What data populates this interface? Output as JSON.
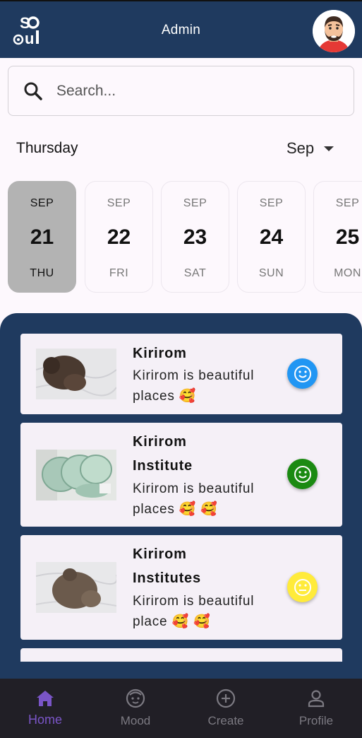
{
  "header": {
    "title": "Admin",
    "logo_text": "Soul",
    "bg_color": "#1f3a5f"
  },
  "search": {
    "placeholder": "Search...",
    "value": ""
  },
  "calendar": {
    "day_label": "Thursday",
    "month_select": "Sep",
    "dates": [
      {
        "month": "SEP",
        "day": "21",
        "weekday": "THU",
        "selected": true
      },
      {
        "month": "SEP",
        "day": "22",
        "weekday": "FRI",
        "selected": false
      },
      {
        "month": "SEP",
        "day": "23",
        "weekday": "SAT",
        "selected": false
      },
      {
        "month": "SEP",
        "day": "24",
        "weekday": "SUN",
        "selected": false
      },
      {
        "month": "SEP",
        "day": "25",
        "weekday": "MON",
        "selected": false
      }
    ]
  },
  "feed": {
    "posts": [
      {
        "title_lines": [
          "Kirirom"
        ],
        "body_lines": [
          "Kirirom is beautiful",
          "places 🥰"
        ],
        "mood": "happy",
        "mood_color": "#2196f3",
        "image": "cat-on-blanket"
      },
      {
        "title_lines": [
          "Kirirom",
          "Institute"
        ],
        "body_lines": [
          "Kirirom is beautiful",
          "places 🥰 🥰"
        ],
        "mood": "happy",
        "mood_color": "#1b8a12",
        "image": "green-dishes"
      },
      {
        "title_lines": [
          "Kirirom",
          "Institutes"
        ],
        "body_lines": [
          "Kirirom is beautiful",
          "place 🥰 🥰"
        ],
        "mood": "neutral",
        "mood_color": "#ffeb3b",
        "image": "cat-on-blanket"
      }
    ]
  },
  "nav": {
    "items": [
      {
        "label": "Home",
        "icon": "home-icon",
        "active": true
      },
      {
        "label": "Mood",
        "icon": "face-icon",
        "active": false
      },
      {
        "label": "Create",
        "icon": "add-circle-icon",
        "active": false
      },
      {
        "label": "Profile",
        "icon": "person-icon",
        "active": false
      }
    ],
    "active_color": "#7a55c7"
  }
}
